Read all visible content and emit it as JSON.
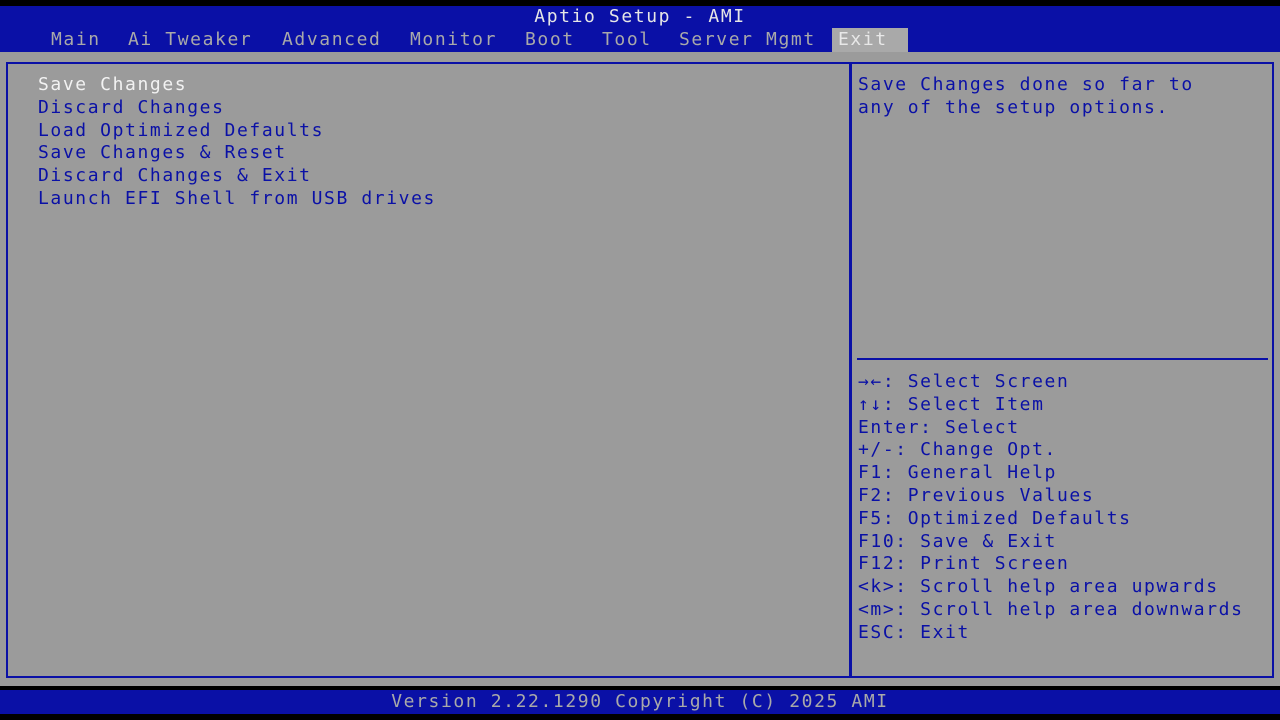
{
  "header": {
    "title": "Aptio Setup - AMI"
  },
  "tabs": [
    {
      "label": "Main"
    },
    {
      "label": "Ai Tweaker"
    },
    {
      "label": "Advanced"
    },
    {
      "label": "Monitor"
    },
    {
      "label": "Boot"
    },
    {
      "label": "Tool"
    },
    {
      "label": "Server Mgmt"
    },
    {
      "label": "Exit",
      "active": true
    }
  ],
  "menu": {
    "items": [
      {
        "label": "Save Changes",
        "selected": true
      },
      {
        "label": "Discard Changes"
      },
      {
        "label": "Load Optimized Defaults"
      },
      {
        "label": "Save Changes & Reset"
      },
      {
        "label": "Discard Changes & Exit"
      },
      {
        "label": "Launch EFI Shell from USB drives"
      }
    ]
  },
  "help": {
    "text": "Save Changes done so far to\nany of the setup options."
  },
  "keys": [
    {
      "text": "→←: Select Screen"
    },
    {
      "text": "↑↓: Select Item"
    },
    {
      "text": "Enter: Select"
    },
    {
      "text": "+/-: Change Opt."
    },
    {
      "text": "F1: General Help"
    },
    {
      "text": "F2: Previous Values"
    },
    {
      "text": "F5: Optimized Defaults"
    },
    {
      "text": "F10: Save & Exit"
    },
    {
      "text": "F12: Print Screen"
    },
    {
      "text": "<k>: Scroll help area upwards"
    },
    {
      "text": "<m>: Scroll help area downwards"
    },
    {
      "text": "ESC: Exit"
    }
  ],
  "footer": {
    "version": "Version 2.22.1290 Copyright (C) 2025 AMI"
  },
  "colors": {
    "bar_blue": "#0a10a6",
    "panel_gray": "#9b9b9b",
    "tab_text": "#a9a9a9",
    "selected_text": "#f2f2f2"
  }
}
